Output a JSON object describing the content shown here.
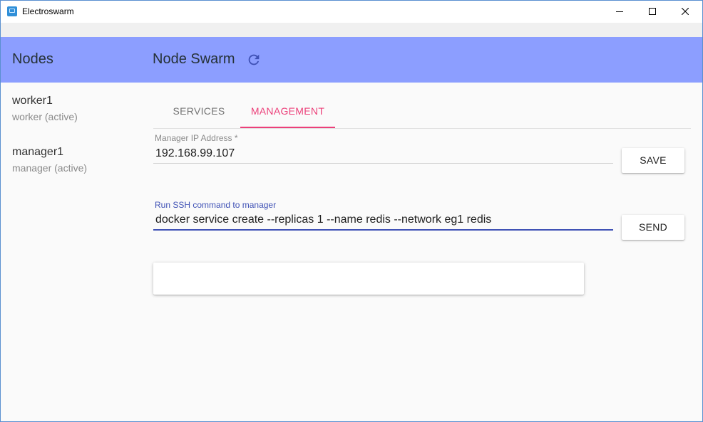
{
  "window": {
    "title": "Electroswarm",
    "controls": [
      "minimize-icon",
      "maximize-icon",
      "close-icon"
    ]
  },
  "appbar": {
    "sidebar_title": "Nodes",
    "title": "Node Swarm",
    "refresh_icon": "refresh-icon",
    "color": "#8c9eff"
  },
  "sidebar": {
    "items": [
      {
        "name": "worker1",
        "role": "worker (active)"
      },
      {
        "name": "manager1",
        "role": "manager (active)"
      }
    ]
  },
  "tabs": [
    {
      "label": "SERVICES",
      "active": false
    },
    {
      "label": "MANAGEMENT",
      "active": true
    }
  ],
  "form": {
    "manager_ip": {
      "label": "Manager IP Address *",
      "value": "192.168.99.107"
    },
    "save_label": "SAVE",
    "ssh": {
      "label": "Run SSH command to manager",
      "value": "docker service create --replicas 1 --name redis --network eg1 redis"
    },
    "send_label": "SEND",
    "output": ""
  },
  "colors": {
    "accent": "#ec407a",
    "primary": "#3f51b5"
  }
}
